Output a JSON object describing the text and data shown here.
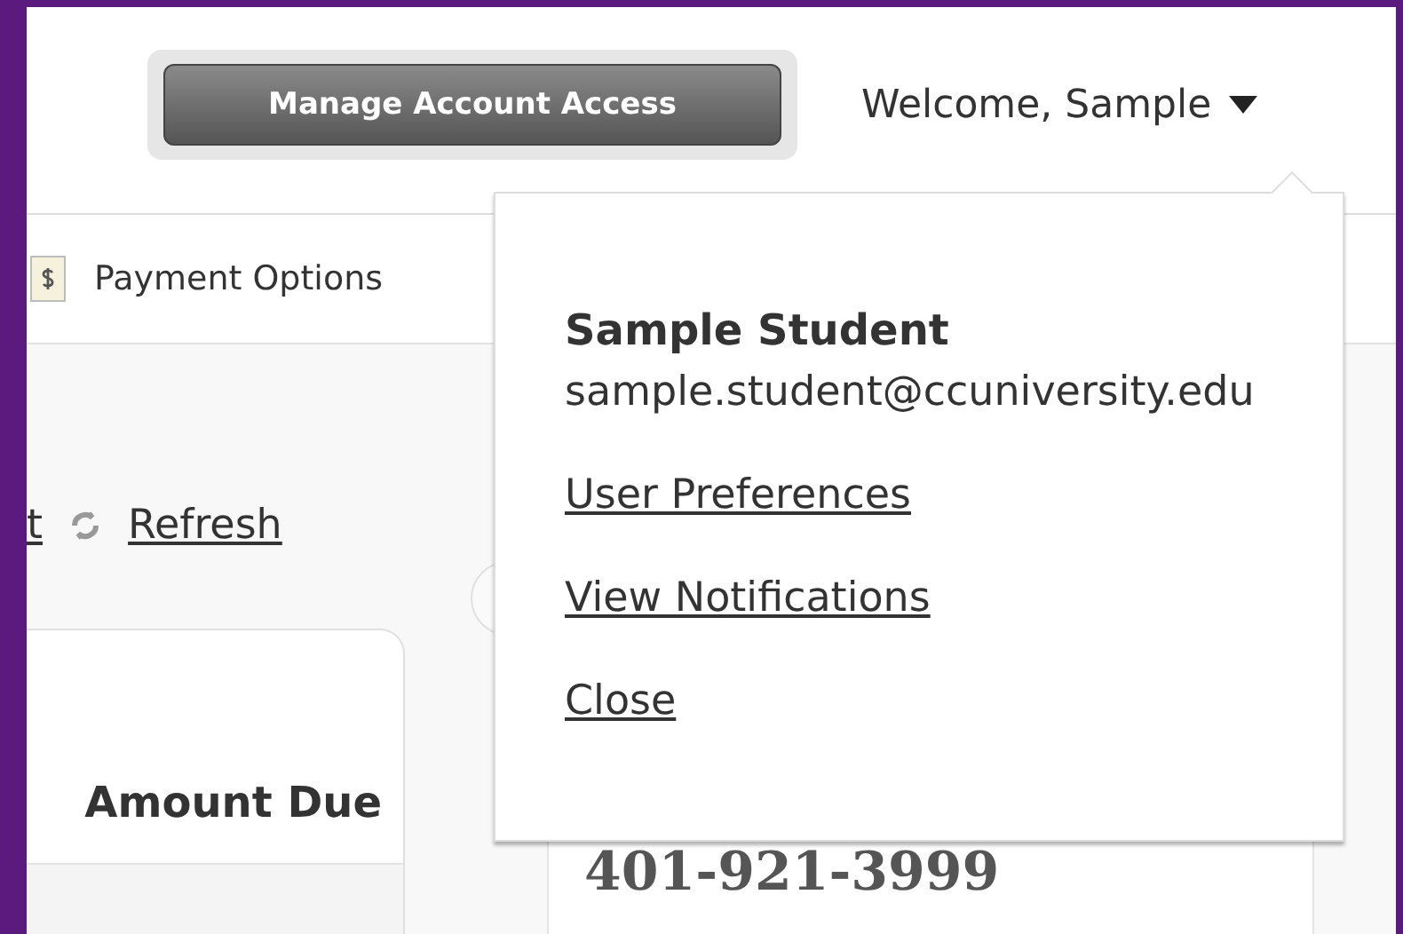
{
  "header": {
    "button": "Manage Account Access",
    "welcome": "Welcome, Sample"
  },
  "nav": {
    "items": [
      {
        "label": "Payment Options"
      }
    ]
  },
  "toolbar": {
    "links": [
      "t",
      "Refresh"
    ]
  },
  "card": {
    "column_header": "Amount Due"
  },
  "contact": {
    "phone": "401-921-3999"
  },
  "user_menu": {
    "name": "Sample Student",
    "email": "sample.student@ccuniversity.edu",
    "links": [
      "User Preferences",
      "View Notifications",
      "Close"
    ]
  }
}
